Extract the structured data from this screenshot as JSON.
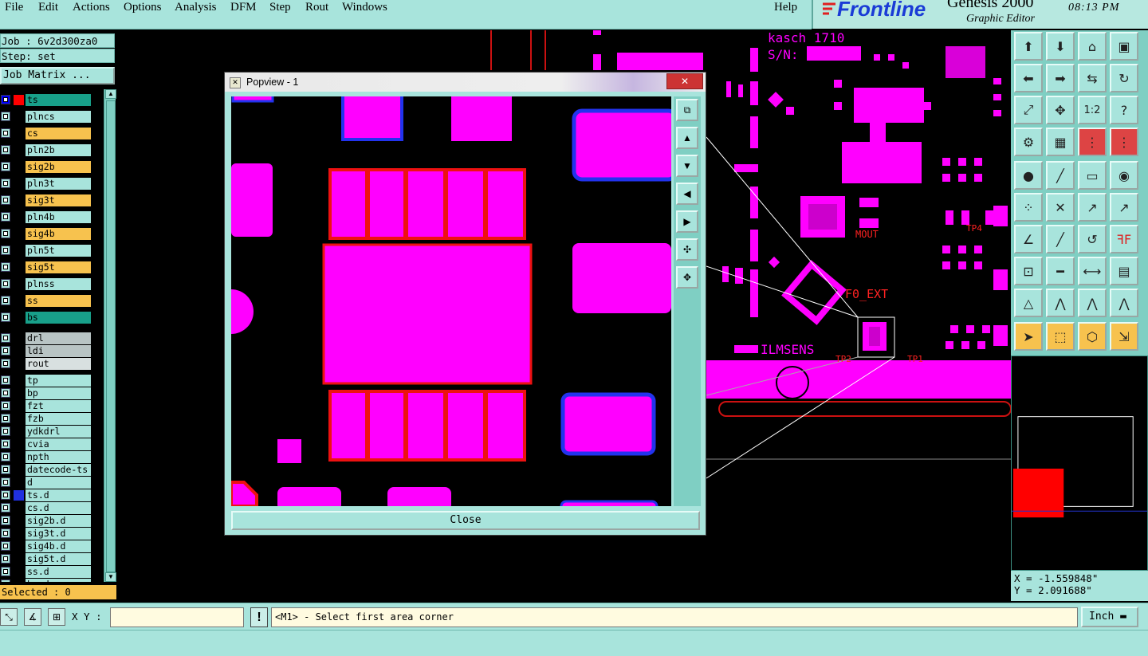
{
  "menu": {
    "items": [
      "File",
      "Edit",
      "Actions",
      "Options",
      "Analysis",
      "DFM",
      "Step",
      "Rout",
      "Windows"
    ],
    "help": "Help"
  },
  "brand": {
    "logo": "Frontline",
    "title": "Genesis 2000",
    "subtitle": "Graphic Editor",
    "time": "08:13 PM"
  },
  "job": {
    "job_line": "Job : 6v2d300za0",
    "step_line": "Step: set",
    "matrix_button": "Job Matrix ..."
  },
  "layers": [
    {
      "name": "ts",
      "color": "#18a08a",
      "swatch": "#ff0000",
      "check": "#0000ff"
    },
    {
      "name": "plncs",
      "color": "#a8e4dc",
      "swatch": null
    },
    {
      "name": "cs",
      "color": "#f7c24e",
      "swatch": null
    },
    {
      "name": "pln2b",
      "color": "#a8e4dc",
      "swatch": null
    },
    {
      "name": "sig2b",
      "color": "#f7c24e",
      "swatch": null
    },
    {
      "name": "pln3t",
      "color": "#a8e4dc",
      "swatch": null
    },
    {
      "name": "sig3t",
      "color": "#f7c24e",
      "swatch": null
    },
    {
      "name": "pln4b",
      "color": "#a8e4dc",
      "swatch": null
    },
    {
      "name": "sig4b",
      "color": "#f7c24e",
      "swatch": null
    },
    {
      "name": "pln5t",
      "color": "#a8e4dc",
      "swatch": null
    },
    {
      "name": "sig5t",
      "color": "#f7c24e",
      "swatch": null
    },
    {
      "name": "plnss",
      "color": "#a8e4dc",
      "swatch": null
    },
    {
      "name": "ss",
      "color": "#f7c24e",
      "swatch": null
    },
    {
      "name": "bs",
      "color": "#18a08a",
      "swatch": null
    },
    {
      "name": "drl",
      "color": "#b8c4c4",
      "swatch": null
    },
    {
      "name": "ldi",
      "color": "#b8c4c4",
      "swatch": null
    },
    {
      "name": "rout",
      "color": "#d8e0e0",
      "swatch": null
    },
    {
      "name": "tp",
      "color": "#a8e4dc",
      "swatch": null
    },
    {
      "name": "bp",
      "color": "#a8e4dc",
      "swatch": null
    },
    {
      "name": "fzt",
      "color": "#a8e4dc",
      "swatch": null
    },
    {
      "name": "fzb",
      "color": "#a8e4dc",
      "swatch": null
    },
    {
      "name": "ydkdrl",
      "color": "#a8e4dc",
      "swatch": null
    },
    {
      "name": "cvia",
      "color": "#a8e4dc",
      "swatch": null
    },
    {
      "name": "npth",
      "color": "#a8e4dc",
      "swatch": null
    },
    {
      "name": "datecode-ts",
      "color": "#a8e4dc",
      "swatch": null
    },
    {
      "name": "d",
      "color": "#a8e4dc",
      "swatch": null
    },
    {
      "name": "ts.d",
      "color": "#a8e4dc",
      "swatch": "#2030e0"
    },
    {
      "name": "cs.d",
      "color": "#a8e4dc",
      "swatch": null
    },
    {
      "name": "sig2b.d",
      "color": "#a8e4dc",
      "swatch": null
    },
    {
      "name": "sig3t.d",
      "color": "#a8e4dc",
      "swatch": null
    },
    {
      "name": "sig4b.d",
      "color": "#a8e4dc",
      "swatch": null
    },
    {
      "name": "sig5t.d",
      "color": "#a8e4dc",
      "swatch": null
    },
    {
      "name": "ss.d",
      "color": "#a8e4dc",
      "swatch": null
    },
    {
      "name": "bs.d",
      "color": "#a8e4dc",
      "swatch": null
    }
  ],
  "selected": "Selected : 0",
  "coords": {
    "x": "X = -1.559848\"",
    "y": "Y = 2.091688\""
  },
  "board_labels": {
    "kasch": "kasch 1710",
    "sn": "S/N:",
    "mout": "MOUT",
    "tp4": "TP4",
    "f0ext": "F0_EXT",
    "ilmsens": "ILMSENS",
    "tp2": "TP2",
    "tp1": "TP1"
  },
  "popview": {
    "title": "Popview - 1",
    "close_x": "✕",
    "close_button": "Close"
  },
  "bottom": {
    "xy_label": "X Y :",
    "xy_value": "",
    "prompt": "<M1> - Select first area corner",
    "unit": "Inch",
    "unit_arrow": "▬"
  },
  "tool_glyphs": {
    "fit": "1:2",
    "help": "?"
  }
}
